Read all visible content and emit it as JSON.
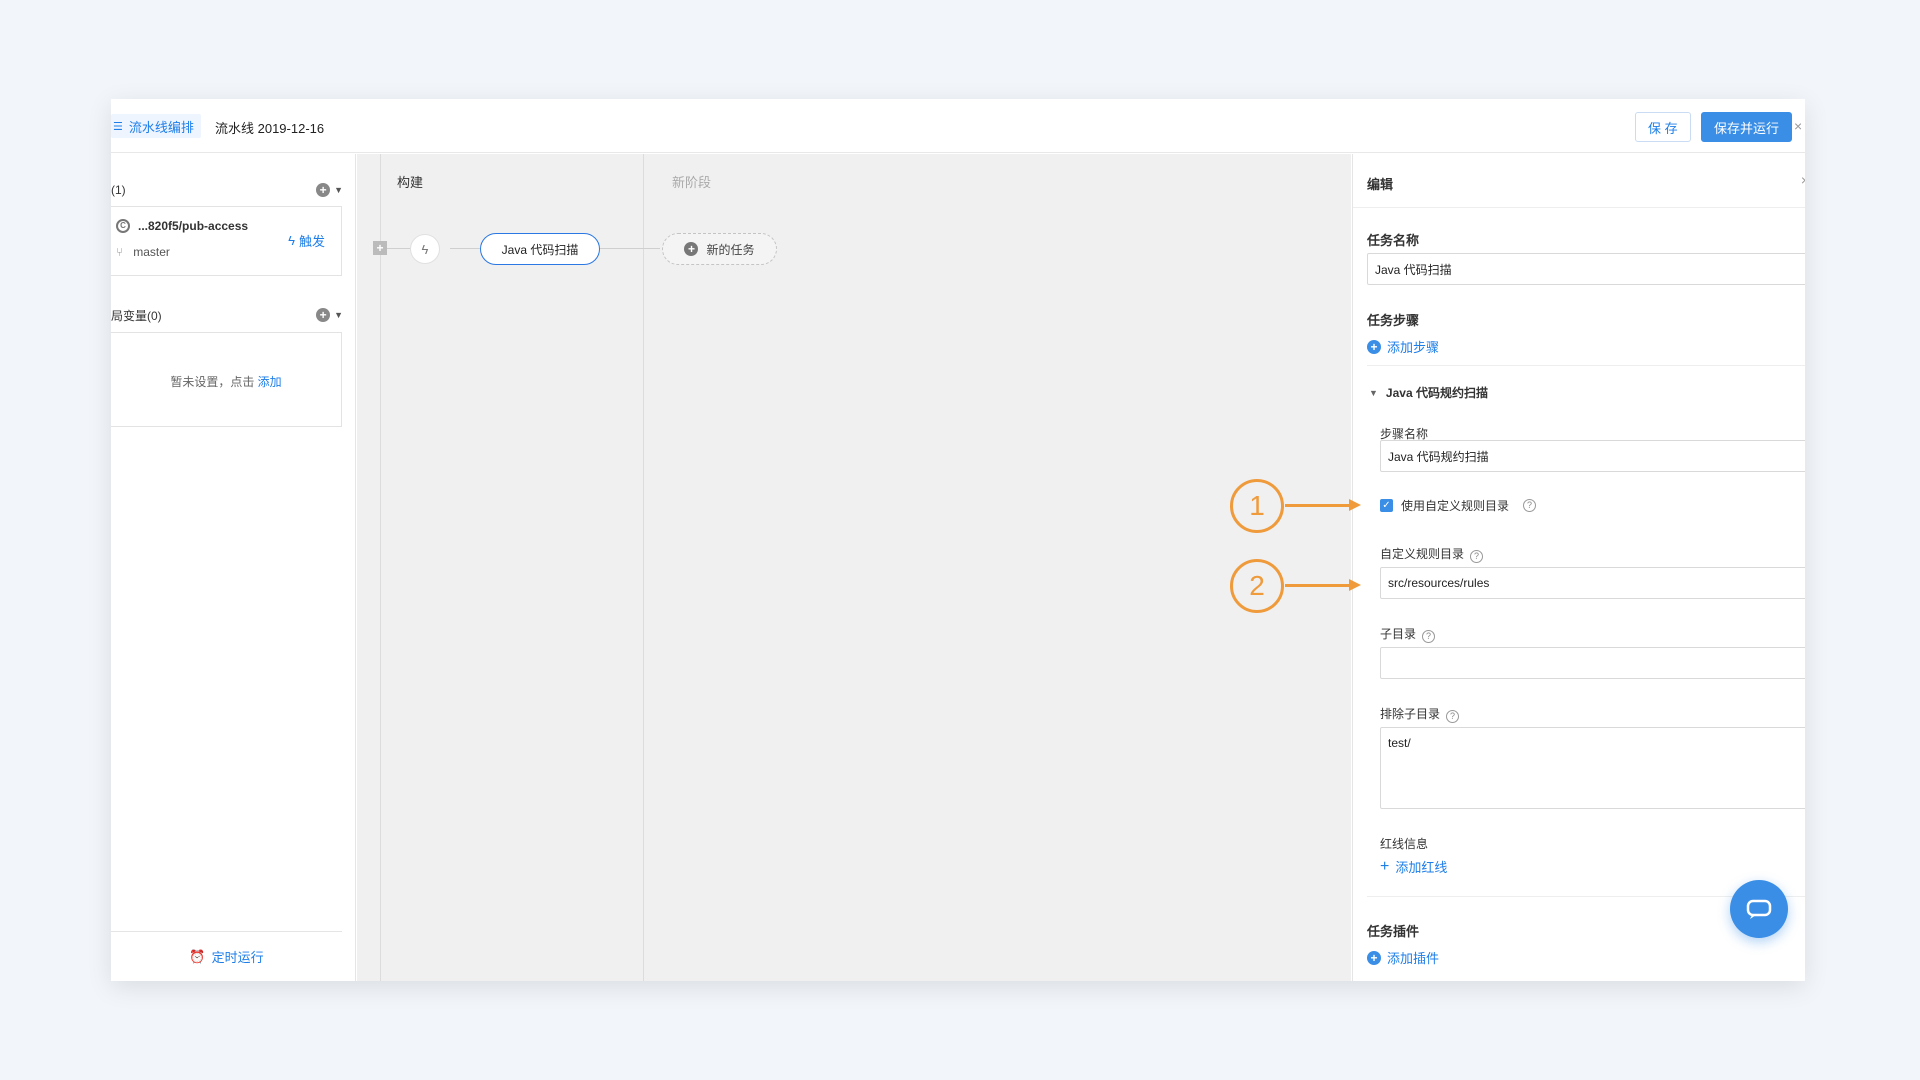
{
  "topbar": {
    "active_tab": "流水线编排",
    "pipeline_title": "流水线 2019-12-16",
    "save_label": "保 存",
    "save_run_label": "保存并运行",
    "close": "×"
  },
  "left": {
    "source_header": "(1)",
    "repo_name": "...820f5/pub-access",
    "branch": "master",
    "trigger_label": "触发",
    "vars_header": "局变量(0)",
    "vars_empty": "暂未设置，点击",
    "vars_add": "添加",
    "schedule_label": "定时运行"
  },
  "canvas": {
    "stage_build": "构建",
    "stage_new": "新阶段",
    "task_name": "Java 代码扫描",
    "new_task": "新的任务"
  },
  "edit": {
    "title": "编辑",
    "task_name_label": "任务名称",
    "task_name_value": "Java 代码扫描",
    "steps_label": "任务步骤",
    "add_step": "添加步骤",
    "step_title": "Java 代码规约扫描",
    "step_name_label": "步骤名称",
    "step_name_value": "Java 代码规约扫描",
    "use_custom_label": "使用自定义规则目录",
    "custom_dir_label": "自定义规则目录",
    "custom_dir_value": "src/resources/rules",
    "subdir_label": "子目录",
    "subdir_value": "",
    "exclude_label": "排除子目录",
    "exclude_value": "test/",
    "redline_label": "红线信息",
    "add_redline": "添加红线",
    "plugins_label": "任务插件",
    "add_plugin": "添加插件"
  },
  "annotations": [
    "1",
    "2"
  ],
  "colors": {
    "accent": "#3a8ee6",
    "link": "#1e7ee8",
    "annotation": "#ef9a3b"
  }
}
